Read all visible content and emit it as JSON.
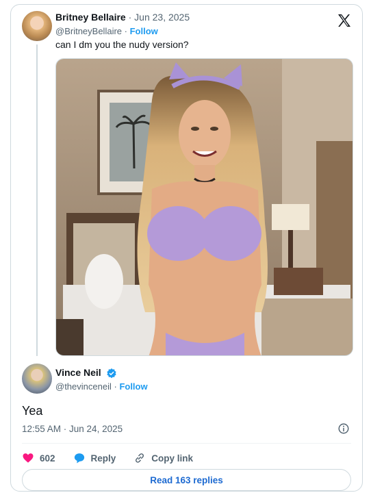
{
  "original_tweet": {
    "display_name": "Britney Bellaire",
    "date": "Jun 23, 2025",
    "handle": "@BritneyBellaire",
    "follow_label": "Follow",
    "text": "can I dm you the nudy version?"
  },
  "reply_tweet": {
    "display_name": "Vince Neil",
    "handle": "@thevinceneil",
    "follow_label": "Follow",
    "text": "Yea",
    "timestamp": "12:55 AM · Jun 24, 2025",
    "verified": true
  },
  "actions": {
    "like_count": "602",
    "reply_label": "Reply",
    "copy_link_label": "Copy link"
  },
  "read_replies_label": "Read 163 replies",
  "icons": [
    "x-logo-icon",
    "verified-badge-icon",
    "info-icon",
    "heart-icon",
    "reply-bubble-icon",
    "link-icon"
  ],
  "colors": {
    "accent": "#1d9bf0",
    "like": "#f91880",
    "text_secondary": "#536471",
    "border": "#cfd9de"
  }
}
